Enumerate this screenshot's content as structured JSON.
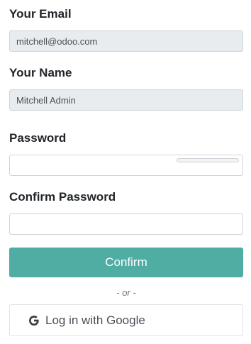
{
  "email": {
    "label": "Your Email",
    "value": "mitchell@odoo.com"
  },
  "name": {
    "label": "Your Name",
    "value": "Mitchell Admin"
  },
  "password": {
    "label": "Password",
    "value": ""
  },
  "confirm_password": {
    "label": "Confirm Password",
    "value": ""
  },
  "confirm_button": {
    "label": "Confirm",
    "color": "#4fada4"
  },
  "separator": {
    "text": "- or -"
  },
  "google_button": {
    "label": "Log in with Google",
    "icon": "google-g-icon"
  }
}
